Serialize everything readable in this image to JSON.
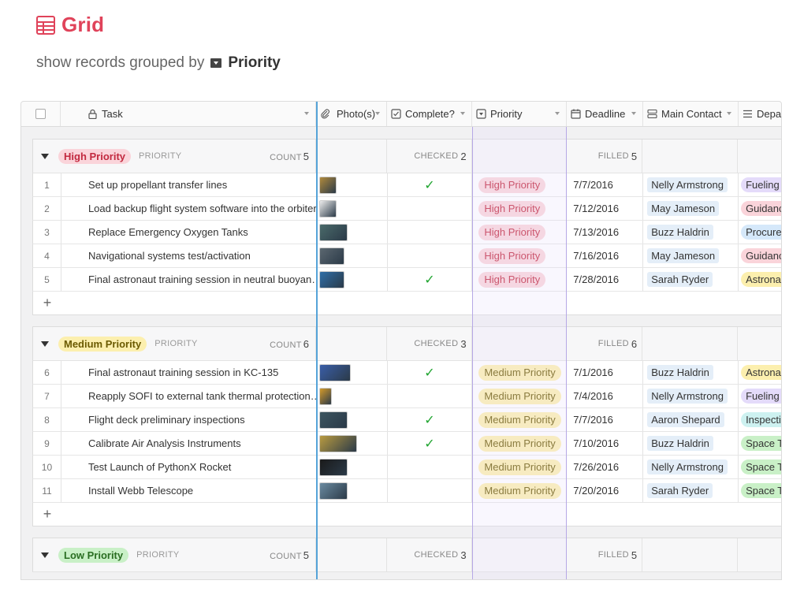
{
  "title": "Grid",
  "groupby": {
    "prefix": "show records grouped by",
    "field": "Priority"
  },
  "columns": {
    "task": "Task",
    "photos": "Photo(s)",
    "complete": "Complete?",
    "priority": "Priority",
    "deadline": "Deadline",
    "contact": "Main Contact",
    "dept": "Depa"
  },
  "groups": [
    {
      "label": "High Priority",
      "field_label": "PRIORITY",
      "count_label": "COUNT",
      "count": "5",
      "checked_label": "CHECKED",
      "checked": "2",
      "filled_label": "FILLED",
      "filled": "5",
      "rows": [
        {
          "num": "1",
          "task": "Set up propellant transfer lines",
          "complete": true,
          "priority": "High Priority",
          "deadline": "7/7/2016",
          "contact": "Nelly Armstrong",
          "dept": "Fueling"
        },
        {
          "num": "2",
          "task": "Load backup flight system software into the orbiter",
          "complete": false,
          "priority": "High Priority",
          "deadline": "7/12/2016",
          "contact": "May Jameson",
          "dept": "Guidanc"
        },
        {
          "num": "3",
          "task": "Replace Emergency Oxygen Tanks",
          "complete": false,
          "priority": "High Priority",
          "deadline": "7/13/2016",
          "contact": "Buzz Haldrin",
          "dept": "Procure"
        },
        {
          "num": "4",
          "task": "Navigational systems test/activation",
          "complete": false,
          "priority": "High Priority",
          "deadline": "7/16/2016",
          "contact": "May Jameson",
          "dept": "Guidanc"
        },
        {
          "num": "5",
          "task": "Final astronaut training session in neutral buoyan…",
          "complete": true,
          "priority": "High Priority",
          "deadline": "7/28/2016",
          "contact": "Sarah Ryder",
          "dept": "Astrona"
        }
      ]
    },
    {
      "label": "Medium Priority",
      "field_label": "PRIORITY",
      "count_label": "COUNT",
      "count": "6",
      "checked_label": "CHECKED",
      "checked": "3",
      "filled_label": "FILLED",
      "filled": "6",
      "rows": [
        {
          "num": "6",
          "task": "Final astronaut training session in KC-135",
          "complete": true,
          "priority": "Medium Priority",
          "deadline": "7/1/2016",
          "contact": "Buzz Haldrin",
          "dept": "Astrona"
        },
        {
          "num": "7",
          "task": "Reapply SOFI to external tank thermal protection…",
          "complete": false,
          "priority": "Medium Priority",
          "deadline": "7/4/2016",
          "contact": "Nelly Armstrong",
          "dept": "Fueling"
        },
        {
          "num": "8",
          "task": "Flight deck preliminary inspections",
          "complete": true,
          "priority": "Medium Priority",
          "deadline": "7/7/2016",
          "contact": "Aaron Shepard",
          "dept": "Inspecti"
        },
        {
          "num": "9",
          "task": "Calibrate Air Analysis Instruments",
          "complete": true,
          "priority": "Medium Priority",
          "deadline": "7/10/2016",
          "contact": "Buzz Haldrin",
          "dept": "Space T"
        },
        {
          "num": "10",
          "task": "Test Launch of PythonX Rocket",
          "complete": false,
          "priority": "Medium Priority",
          "deadline": "7/26/2016",
          "contact": "Nelly Armstrong",
          "dept": "Space T"
        },
        {
          "num": "11",
          "task": "Install Webb Telescope",
          "complete": false,
          "priority": "Medium Priority",
          "deadline": "7/20/2016",
          "contact": "Sarah Ryder",
          "dept": "Space T"
        }
      ]
    },
    {
      "label": "Low Priority",
      "field_label": "PRIORITY",
      "count_label": "COUNT",
      "count": "5",
      "checked_label": "CHECKED",
      "checked": "3",
      "filled_label": "FILLED",
      "filled": "5",
      "rows": []
    }
  ],
  "add_symbol": "+",
  "check_symbol": "✓",
  "colors": {
    "accent": "#e0435a",
    "high_bg": "#fad4da",
    "medium_bg": "#fcefae",
    "low_bg": "#c9f0c7",
    "contact_bg": "#e4eef8",
    "selected_column_line": "#55a3d8"
  },
  "dept_colors": {
    "Fueling": "#e4dbfa",
    "Guidanc": "#fad4da",
    "Procure": "#d5e8fa",
    "Astrona": "#fcefae",
    "Inspecti": "#cdf1f0",
    "Space T": "#c9f0c7"
  }
}
